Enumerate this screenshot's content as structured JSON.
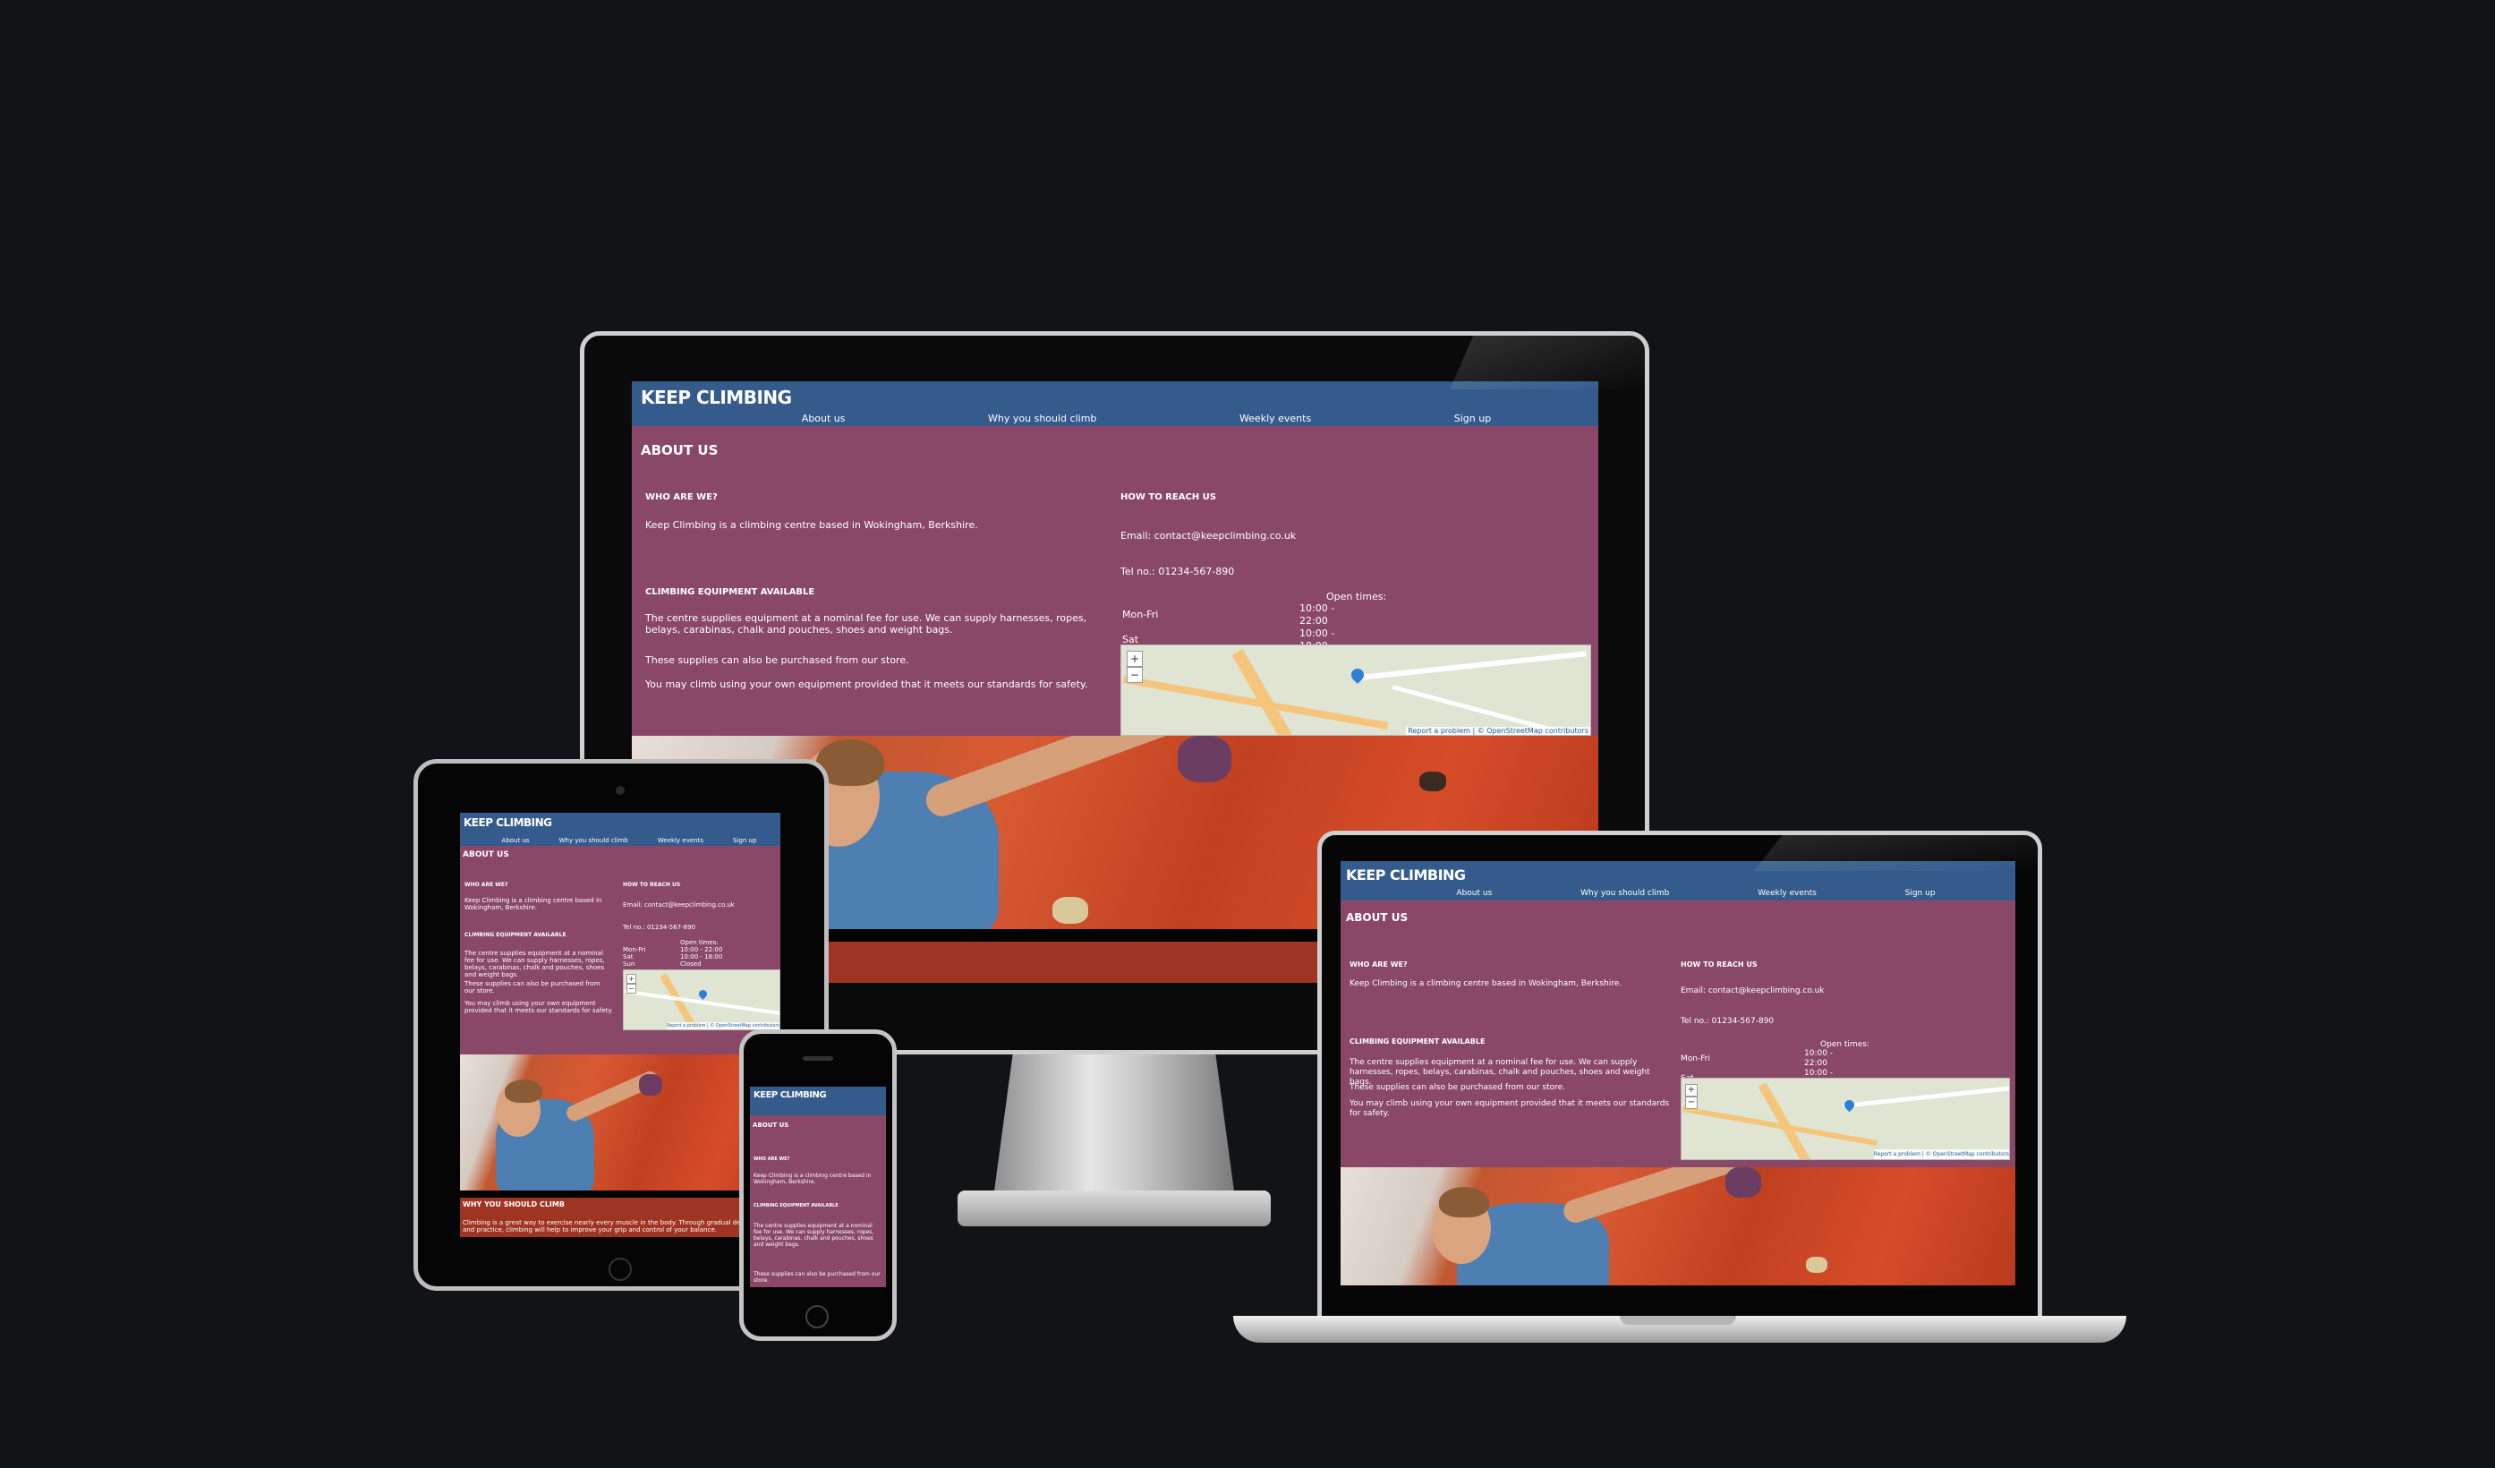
{
  "site": {
    "brand": "Keep Climbing",
    "nav": [
      "About us",
      "Why you should climb",
      "Weekly events",
      "Sign up"
    ],
    "about_heading": "About us",
    "who_heading": "Who are we?",
    "who_text": "Keep Climbing is a climbing centre based in Wokingham, Berkshire.",
    "equip_heading": "Climbing equipment available",
    "equip_text1": "The centre supplies equipment at a nominal fee for use. We can supply harnesses, ropes, belays, carabinas, chalk and pouches, shoes and weight bags.",
    "equip_text2": "These supplies can also be purchased from our store.",
    "equip_text3": "You may climb using your own equipment provided that it meets our standards for safety.",
    "reach_heading": "How to reach us",
    "email": "Email: contact@keepclimbing.co.uk",
    "tel": "Tel no.: 01234-567-890",
    "open_title": "Open times:",
    "hours": [
      {
        "day": "Mon-Fri",
        "time": "10:00 - 22:00"
      },
      {
        "day": "Sat",
        "time": "10:00 - 18:00"
      },
      {
        "day": "Sun",
        "time": "Closed"
      }
    ],
    "map_zoom_in": "+",
    "map_zoom_out": "−",
    "map_attribution": "Report a problem | © OpenStreetMap contributors",
    "why_heading": "Why you should climb",
    "why_text": "Climbing is a great way to exercise nearly every muscle in the body. Through gradual development and practice, climbing will help to improve your grip and control of your balance."
  },
  "colors": {
    "nav": "#355a8c",
    "body": "#8a4869",
    "footer": "#9f3422",
    "background": "#121316"
  }
}
